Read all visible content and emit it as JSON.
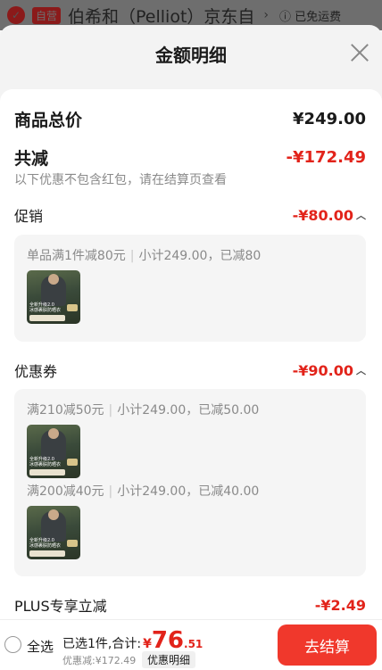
{
  "background": {
    "badge": "自营",
    "store_title": "伯希和（Pelliot）京东自",
    "shipping": "已免运费"
  },
  "sheet": {
    "title": "金额明细"
  },
  "summary": {
    "total_label": "商品总价",
    "total_value": "¥249.00",
    "reduce_label": "共减",
    "reduce_value": "-¥172.49",
    "note": "以下优惠不包含红包，请在结算页查看"
  },
  "promotion": {
    "label": "促销",
    "value": "-¥80.00",
    "items": [
      {
        "rule": "单品满1件减80元",
        "detail": "小计249.00，已减80"
      }
    ]
  },
  "coupon": {
    "label": "优惠券",
    "value": "-¥90.00",
    "items": [
      {
        "rule": "满210减50元",
        "detail": "小计249.00，已减50.00"
      },
      {
        "rule": "满200减40元",
        "detail": "小计249.00，已减40.00"
      }
    ]
  },
  "plus": {
    "label": "PLUS专享立减",
    "value": "-¥2.49"
  },
  "thumb_caption": "全新升级2.0\n冰感裹肤防晒衣",
  "bottom": {
    "select_all": "全选",
    "selected_label": "已选1件,合计:",
    "currency": "¥",
    "total_int": "76",
    "total_dec": ".51",
    "discount": "优惠减:¥172.49",
    "detail_link": "优惠明细",
    "checkout": "去结算"
  },
  "colors": {
    "accent": "#e2231a",
    "checkout_bg": "#f0382c"
  },
  "icons": [
    "check-circle-icon",
    "chevron-right-icon",
    "info-icon",
    "close-icon",
    "chevron-up-icon",
    "radio-icon"
  ]
}
